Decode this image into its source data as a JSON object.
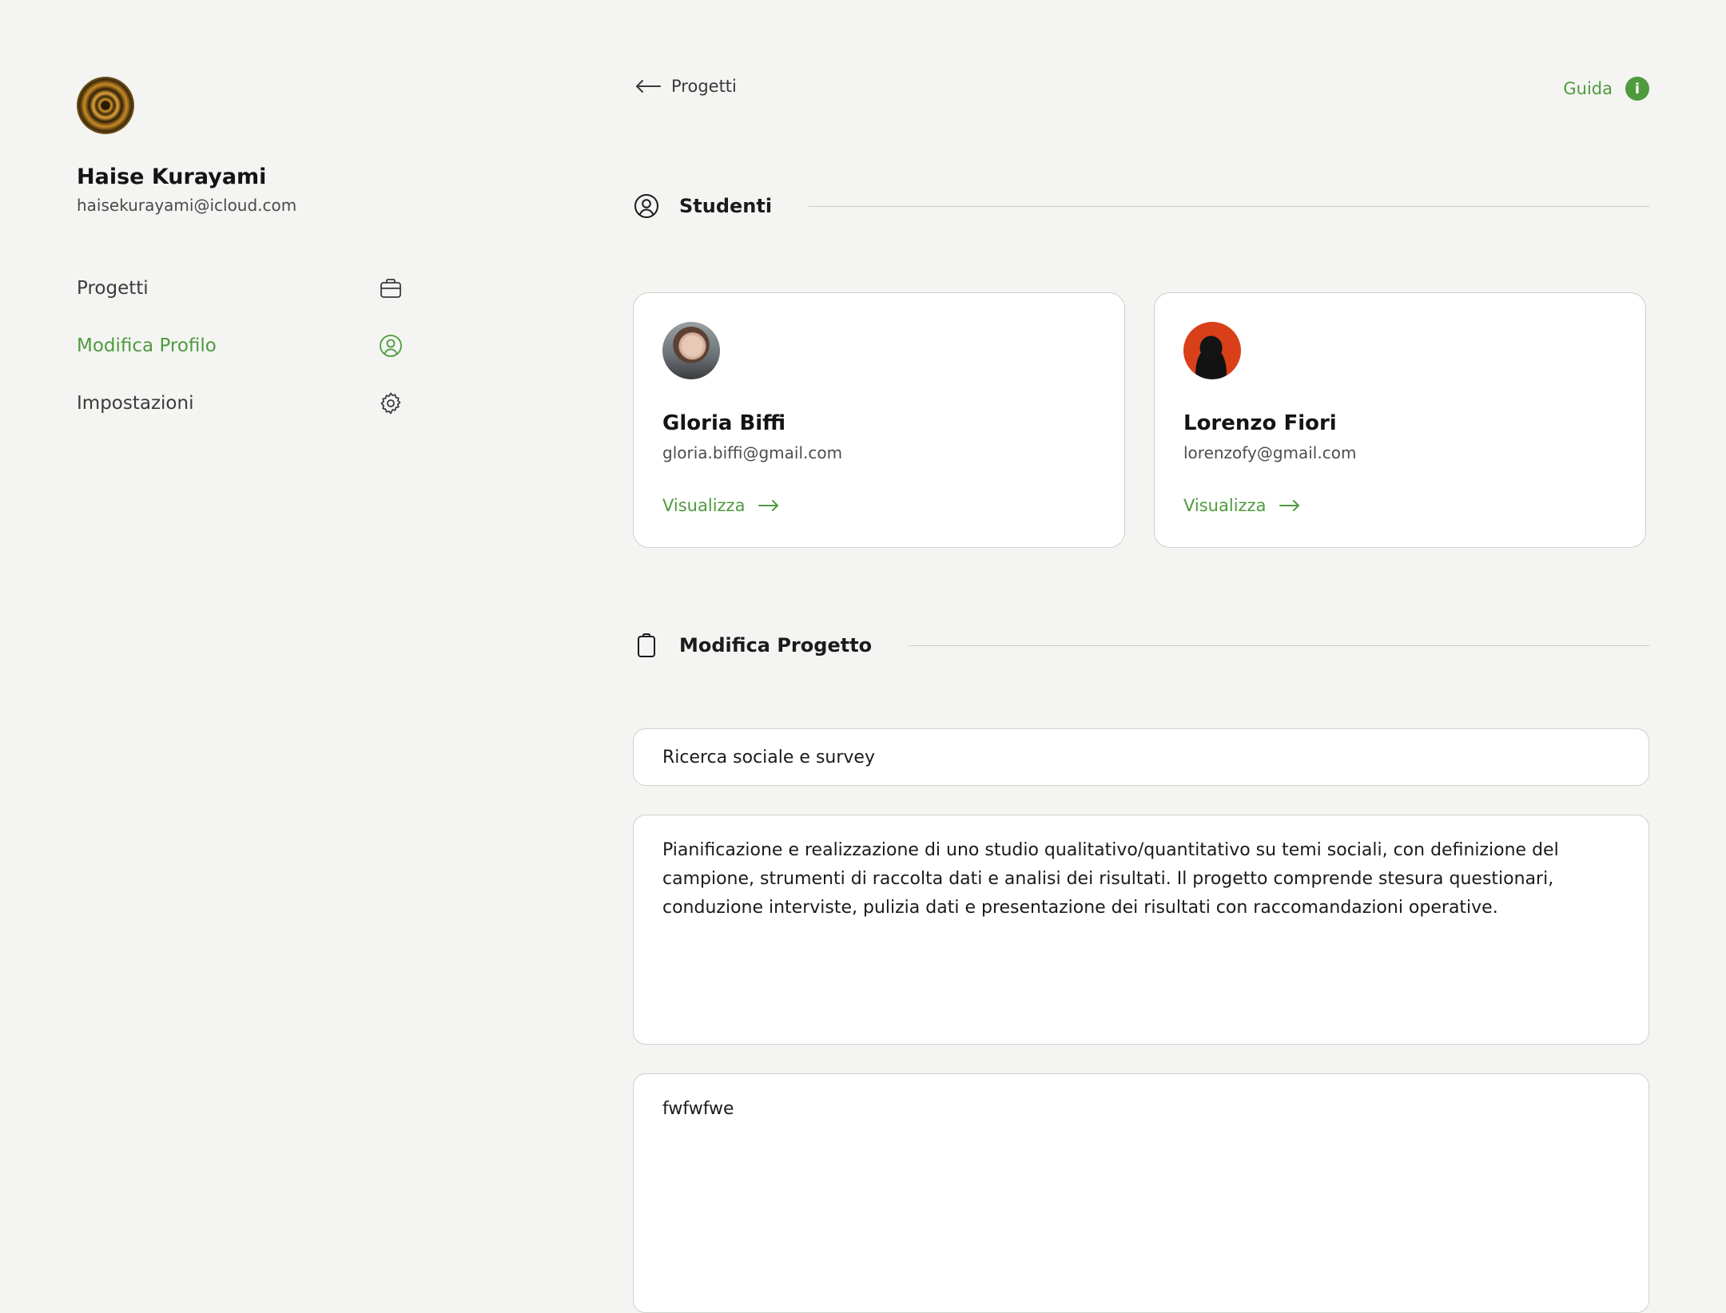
{
  "user": {
    "name": "Haise Kurayami",
    "email": "haisekurayami@icloud.com"
  },
  "nav": {
    "items": [
      {
        "label": "Progetti",
        "icon": "briefcase-icon"
      },
      {
        "label": "Modifica Profilo",
        "icon": "user-circle-icon",
        "active": true
      },
      {
        "label": "Impostazioni",
        "icon": "gear-icon"
      }
    ]
  },
  "topbar": {
    "back_label": "Progetti",
    "help_label": "Guida",
    "help_icon": "i"
  },
  "students_section": {
    "title": "Studenti",
    "students": [
      {
        "name": "Gloria Biffi",
        "email": "gloria.biffi@gmail.com",
        "link": "Visualizza"
      },
      {
        "name": "Lorenzo Fiori",
        "email": "lorenzofy@gmail.com",
        "link": "Visualizza"
      }
    ]
  },
  "edit_section": {
    "title": "Modifica Progetto",
    "project_title": "Ricerca sociale e survey",
    "project_description": "Pianificazione e realizzazione di uno studio qualitativo/quantitativo su temi sociali, con definizione del campione, strumenti di raccolta dati e analisi dei risultati. Il progetto comprende stesura questionari, conduzione interviste, pulizia dati e presentazione dei risultati con raccomandazioni operative.",
    "project_notes": "fwfwfwe"
  },
  "colors": {
    "accent": "#4f9a3f",
    "background": "#f4f5f2",
    "card": "#ffffff",
    "border": "#cfd1cc"
  }
}
